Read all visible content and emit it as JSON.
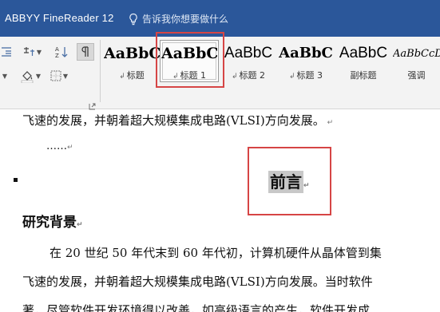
{
  "title_bar": {
    "app_title": "ABBYY FineReader 12",
    "tell_me": "告诉我你想要做什么"
  },
  "ribbon": {
    "styles": [
      {
        "sample": "AaBbC",
        "label": "标题",
        "selected": false
      },
      {
        "sample": "AaBbC",
        "label": "标题 1",
        "selected": true
      },
      {
        "sample": "AaBbC",
        "label": "标题 2",
        "selected": false
      },
      {
        "sample": "AaBbC",
        "label": "标题 3",
        "selected": false
      },
      {
        "sample": "AaBbC",
        "label": "副标题",
        "selected": false
      },
      {
        "sample": "AaBbCcD",
        "label": "强调",
        "selected": false
      }
    ]
  },
  "document": {
    "line1": "飞速的发展，并朝着超大规模集成电路(VLSI)方向发展。",
    "ellipsis": "……",
    "heading_preface": "前言",
    "heading_background": "研究背景",
    "para_line1": "在 20 世纪 50 年代末到 60 年代初，计算机硬件从晶体管到集",
    "para_line2": "飞速的发展，并朝着超大规模集成电路(VLSI)方向发展。当时软件",
    "para_line3": "著，尽管软件开发环境得以改善，如高级语言的产生，软件开发成"
  },
  "colors": {
    "title_bar": "#2b579a",
    "annotation": "#d64545",
    "selection_highlight": "#c8c8c8"
  }
}
